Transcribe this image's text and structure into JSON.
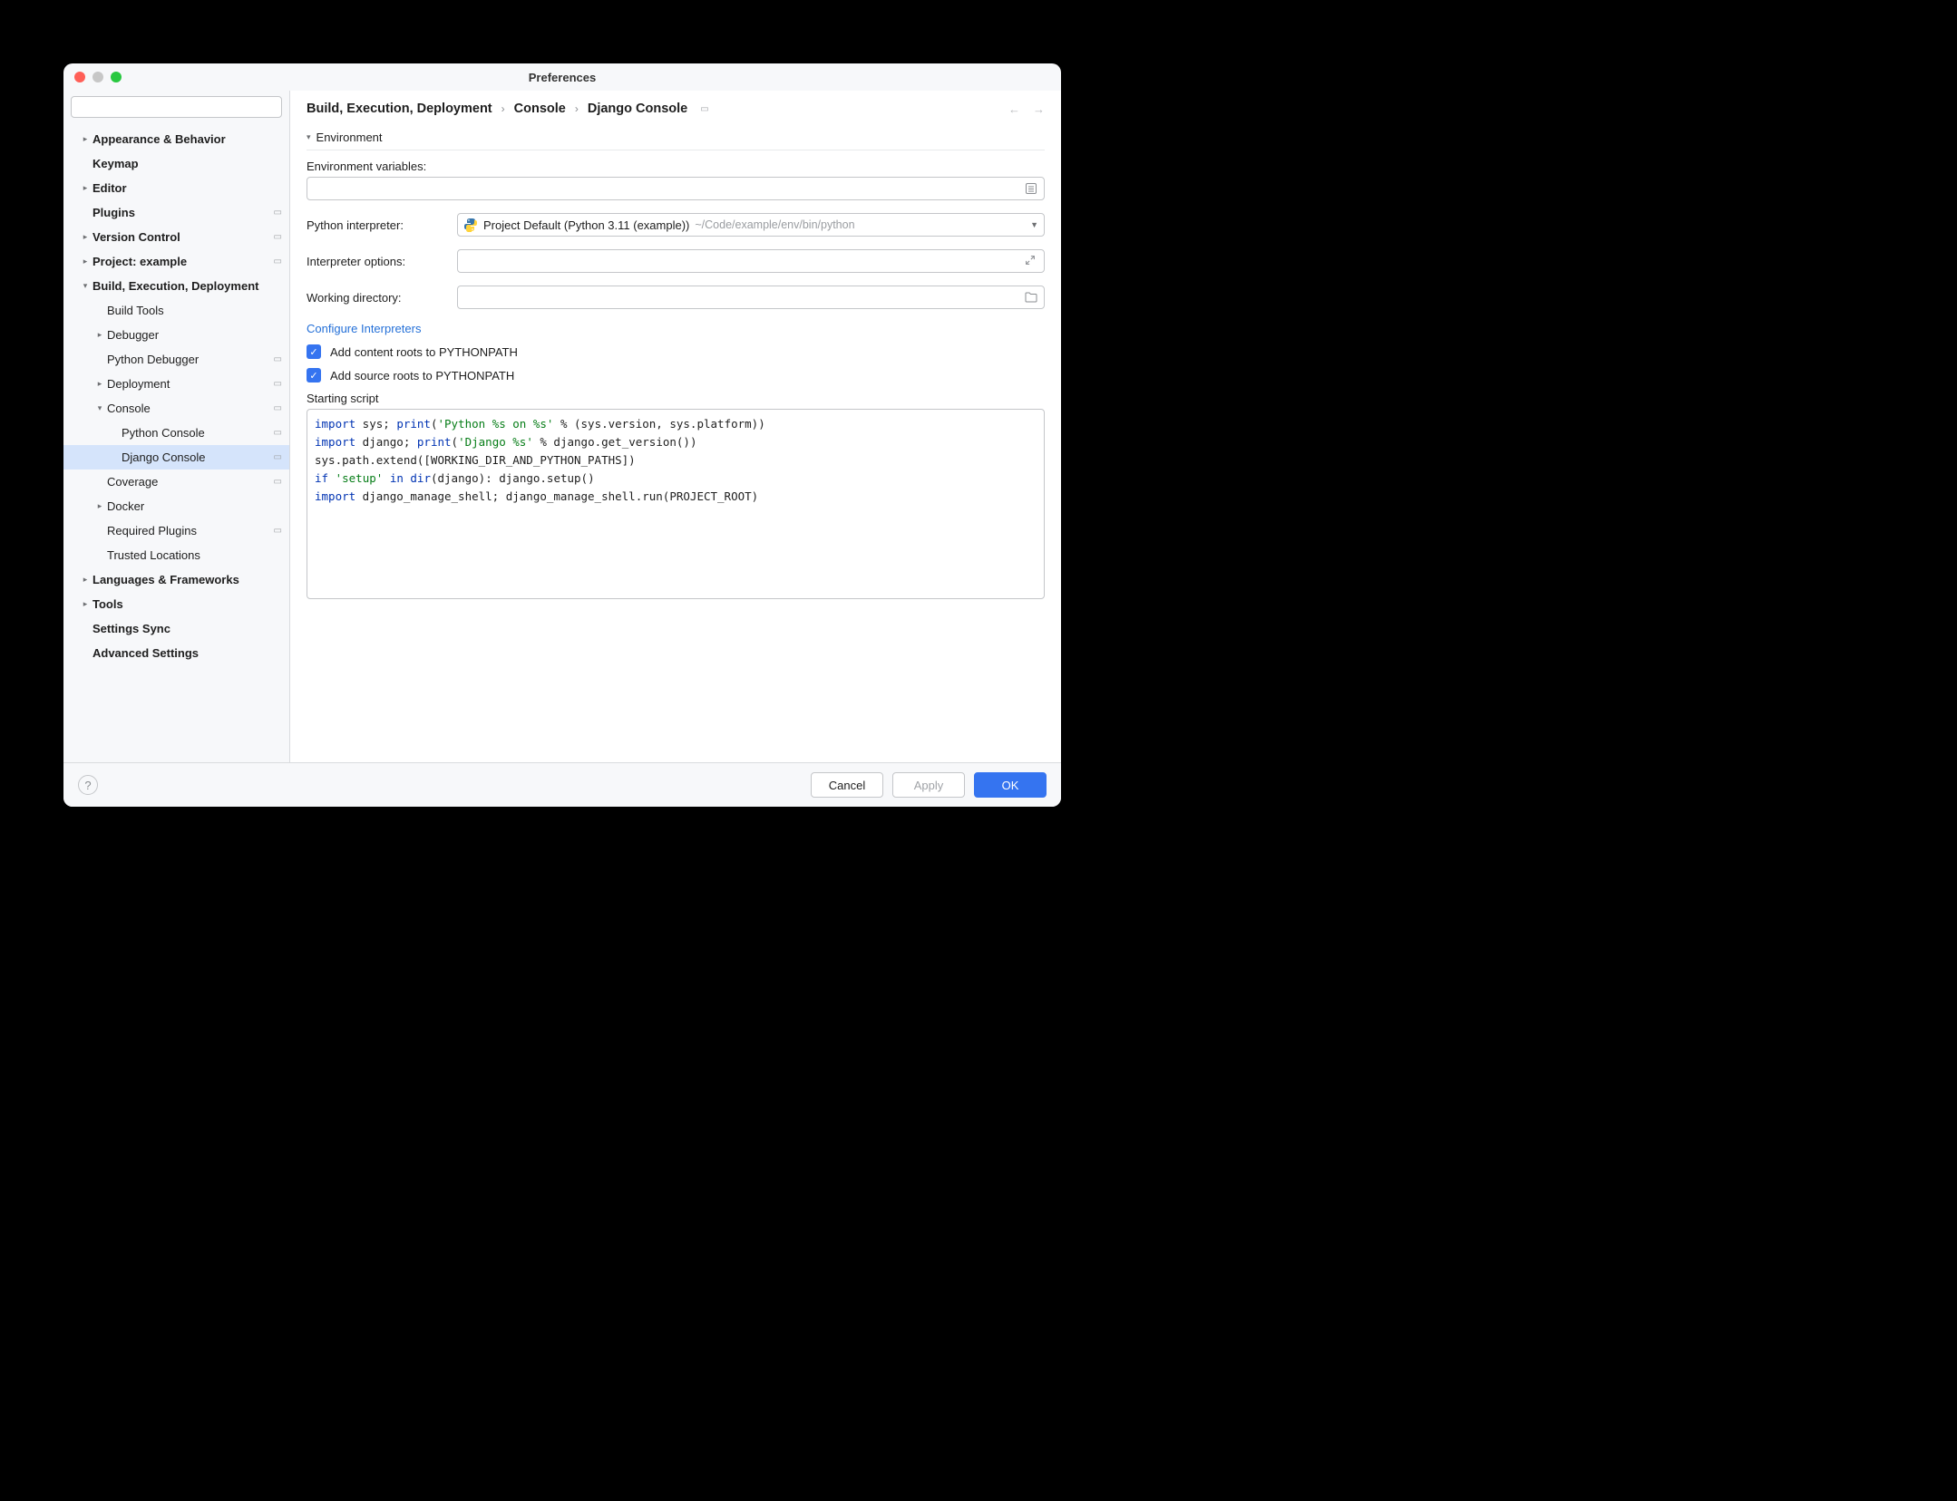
{
  "window": {
    "title": "Preferences"
  },
  "search": {
    "placeholder": ""
  },
  "sidebar": {
    "items": [
      {
        "label": "Appearance & Behavior",
        "bold": true,
        "indent": 0,
        "arrow": "right",
        "badge": false
      },
      {
        "label": "Keymap",
        "bold": true,
        "indent": 0,
        "arrow": "none",
        "badge": false
      },
      {
        "label": "Editor",
        "bold": true,
        "indent": 0,
        "arrow": "right",
        "badge": false
      },
      {
        "label": "Plugins",
        "bold": true,
        "indent": 0,
        "arrow": "none",
        "badge": true
      },
      {
        "label": "Version Control",
        "bold": true,
        "indent": 0,
        "arrow": "right",
        "badge": true
      },
      {
        "label": "Project: example",
        "bold": true,
        "indent": 0,
        "arrow": "right",
        "badge": true
      },
      {
        "label": "Build, Execution, Deployment",
        "bold": true,
        "indent": 0,
        "arrow": "down",
        "badge": false
      },
      {
        "label": "Build Tools",
        "bold": false,
        "indent": 1,
        "arrow": "none",
        "badge": false
      },
      {
        "label": "Debugger",
        "bold": false,
        "indent": 1,
        "arrow": "right",
        "badge": false
      },
      {
        "label": "Python Debugger",
        "bold": false,
        "indent": 1,
        "arrow": "none",
        "badge": true
      },
      {
        "label": "Deployment",
        "bold": false,
        "indent": 1,
        "arrow": "right",
        "badge": true
      },
      {
        "label": "Console",
        "bold": false,
        "indent": 1,
        "arrow": "down",
        "badge": true
      },
      {
        "label": "Python Console",
        "bold": false,
        "indent": 2,
        "arrow": "none",
        "badge": true
      },
      {
        "label": "Django Console",
        "bold": false,
        "indent": 2,
        "arrow": "none",
        "badge": true,
        "selected": true
      },
      {
        "label": "Coverage",
        "bold": false,
        "indent": 1,
        "arrow": "none",
        "badge": true
      },
      {
        "label": "Docker",
        "bold": false,
        "indent": 1,
        "arrow": "right",
        "badge": false
      },
      {
        "label": "Required Plugins",
        "bold": false,
        "indent": 1,
        "arrow": "none",
        "badge": true
      },
      {
        "label": "Trusted Locations",
        "bold": false,
        "indent": 1,
        "arrow": "none",
        "badge": false
      },
      {
        "label": "Languages & Frameworks",
        "bold": true,
        "indent": 0,
        "arrow": "right",
        "badge": false
      },
      {
        "label": "Tools",
        "bold": true,
        "indent": 0,
        "arrow": "right",
        "badge": false
      },
      {
        "label": "Settings Sync",
        "bold": true,
        "indent": 0,
        "arrow": "none",
        "badge": false
      },
      {
        "label": "Advanced Settings",
        "bold": true,
        "indent": 0,
        "arrow": "none",
        "badge": false
      }
    ]
  },
  "breadcrumb": {
    "a": "Build, Execution, Deployment",
    "b": "Console",
    "c": "Django Console"
  },
  "section": {
    "title": "Environment"
  },
  "form": {
    "env_label": "Environment variables:",
    "env_value": "",
    "interp_label": "Python interpreter:",
    "interp_value": "Project Default (Python 3.11 (example))",
    "interp_path": "~/Code/example/env/bin/python",
    "opts_label": "Interpreter options:",
    "opts_value": "",
    "wd_label": "Working directory:",
    "wd_value": ""
  },
  "link": {
    "configure": "Configure Interpreters"
  },
  "checks": {
    "content_roots": "Add content roots to PYTHONPATH",
    "source_roots": "Add source roots to PYTHONPATH"
  },
  "script": {
    "label": "Starting script",
    "l1a": "import",
    "l1b": " sys; ",
    "l1c": "print",
    "l1d": "(",
    "l1e": "'Python %s on %s'",
    "l1f": " % (sys.version, sys.platform))",
    "l2a": "import",
    "l2b": " django; ",
    "l2c": "print",
    "l2d": "(",
    "l2e": "'Django %s'",
    "l2f": " % django.get_version())",
    "l3": "sys.path.extend([WORKING_DIR_AND_PYTHON_PATHS])",
    "l4a": "if",
    "l4b": " ",
    "l4c": "'setup'",
    "l4d": " ",
    "l4e": "in",
    "l4f": " ",
    "l4g": "dir",
    "l4h": "(django): django.setup()",
    "l5a": "import",
    "l5b": " django_manage_shell; django_manage_shell.run(PROJECT_ROOT)"
  },
  "footer": {
    "cancel": "Cancel",
    "apply": "Apply",
    "ok": "OK"
  }
}
